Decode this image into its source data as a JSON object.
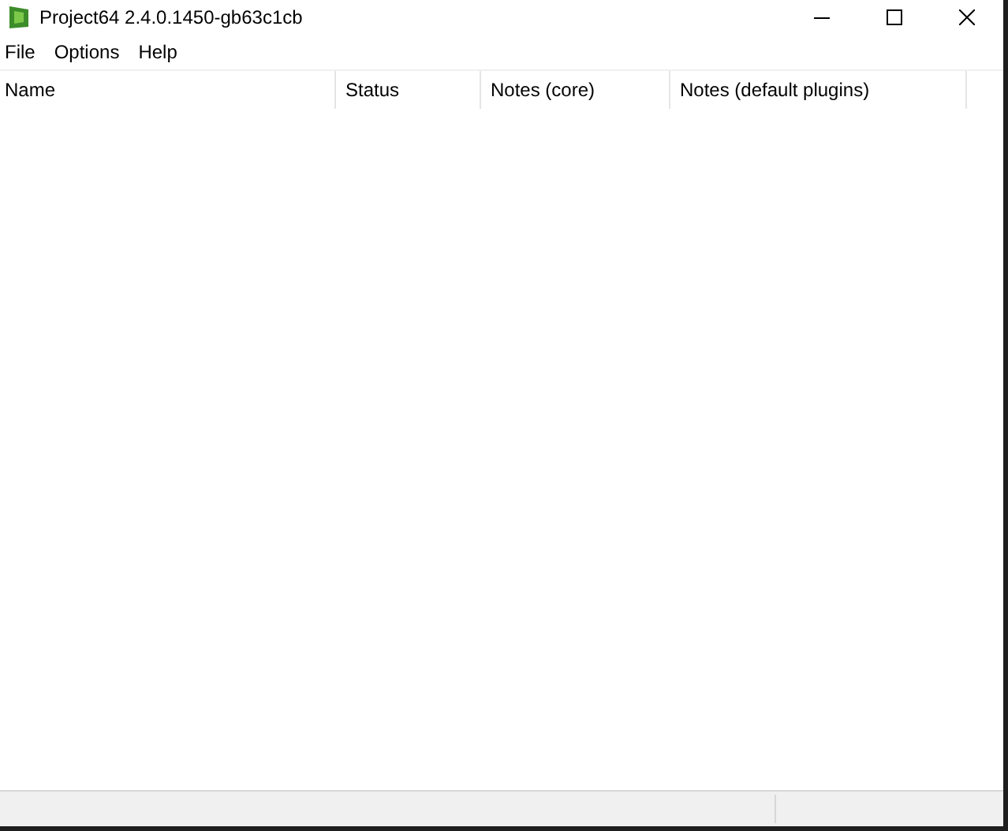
{
  "window": {
    "title": "Project64 2.4.0.1450-gb63c1cb"
  },
  "menu": [
    "File",
    "Options",
    "Help"
  ],
  "table": {
    "columns": [
      "Name",
      "Status",
      "Notes (core)",
      "Notes (default plugins)"
    ]
  }
}
